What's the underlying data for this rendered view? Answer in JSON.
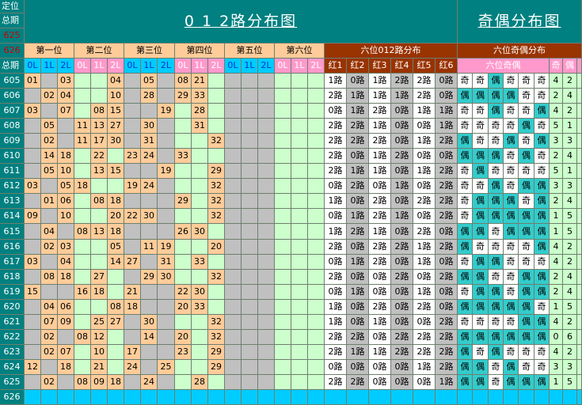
{
  "header": {
    "label_position": "定位",
    "label_total": "总期",
    "label_625": "625",
    "label_626": "626",
    "title_012": "0 1 2路分布图",
    "title_parity": "奇偶分布图",
    "title_012_six": "六位012路分布",
    "title_parity_six": "六位奇偶分布",
    "groups": [
      "第一位",
      "第二位",
      "第三位",
      "第四位",
      "第五位",
      "第六位"
    ],
    "sub_labels": [
      "0L",
      "1L",
      "2L"
    ],
    "red_labels": [
      "红1",
      "红2",
      "红3",
      "红4",
      "红5",
      "红6"
    ],
    "parity_sub": "六位奇偶",
    "odd_label": "奇",
    "even_label": "偶"
  },
  "rows": [
    {
      "p": "605",
      "n": [
        "01",
        null,
        "03",
        null,
        null,
        "04",
        null,
        "05",
        null,
        "08",
        "21",
        null
      ],
      "r": [
        "1路",
        "0路",
        "1路",
        "2路",
        "2路",
        "0路"
      ],
      "o": [
        "奇",
        "奇",
        "偶",
        "奇",
        "奇",
        "奇"
      ],
      "s": [
        "4",
        "2"
      ]
    },
    {
      "p": "606",
      "n": [
        null,
        "02",
        "04",
        null,
        null,
        "10",
        null,
        "28",
        null,
        "29",
        "33",
        null
      ],
      "r": [
        "2路",
        "1路",
        "1路",
        "1路",
        "2路",
        "0路"
      ],
      "o": [
        "偶",
        "偶",
        "偶",
        "偶",
        "奇",
        "奇"
      ],
      "s": [
        "2",
        "4"
      ]
    },
    {
      "p": "607",
      "n": [
        "03",
        null,
        "07",
        null,
        "08",
        "15",
        null,
        null,
        "19",
        null,
        "28",
        null
      ],
      "r": [
        "0路",
        "1路",
        "2路",
        "0路",
        "1路",
        "1路"
      ],
      "o": [
        "奇",
        "奇",
        "偶",
        "奇",
        "奇",
        "偶"
      ],
      "s": [
        "4",
        "2"
      ]
    },
    {
      "p": "608",
      "n": [
        null,
        "05",
        null,
        "11",
        "13",
        "27",
        null,
        "30",
        null,
        null,
        "31",
        null
      ],
      "r": [
        "2路",
        "2路",
        "1路",
        "0路",
        "0路",
        "1路"
      ],
      "o": [
        "奇",
        "奇",
        "奇",
        "奇",
        "偶",
        "奇"
      ],
      "s": [
        "5",
        "1"
      ]
    },
    {
      "p": "609",
      "n": [
        null,
        "02",
        null,
        "11",
        "17",
        "30",
        null,
        "31",
        null,
        null,
        null,
        "32"
      ],
      "r": [
        "2路",
        "2路",
        "2路",
        "0路",
        "1路",
        "2路"
      ],
      "o": [
        "偶",
        "奇",
        "奇",
        "偶",
        "奇",
        "偶"
      ],
      "s": [
        "3",
        "3"
      ]
    },
    {
      "p": "610",
      "n": [
        null,
        "14",
        "18",
        null,
        "22",
        null,
        "23",
        "24",
        null,
        "33",
        null,
        null
      ],
      "r": [
        "2路",
        "0路",
        "1路",
        "2路",
        "0路",
        "0路"
      ],
      "o": [
        "偶",
        "偶",
        "偶",
        "奇",
        "偶",
        "奇"
      ],
      "s": [
        "2",
        "4"
      ]
    },
    {
      "p": "611",
      "n": [
        null,
        "05",
        "10",
        null,
        "13",
        "15",
        null,
        null,
        "19",
        null,
        null,
        "29"
      ],
      "r": [
        "2路",
        "1路",
        "1路",
        "0路",
        "1路",
        "2路"
      ],
      "o": [
        "奇",
        "偶",
        "奇",
        "奇",
        "奇",
        "奇"
      ],
      "s": [
        "5",
        "1"
      ]
    },
    {
      "p": "612",
      "n": [
        "03",
        null,
        "05",
        "18",
        null,
        null,
        "19",
        "24",
        null,
        null,
        null,
        "32"
      ],
      "r": [
        "0路",
        "2路",
        "0路",
        "1路",
        "0路",
        "2路"
      ],
      "o": [
        "奇",
        "奇",
        "偶",
        "奇",
        "偶",
        "偶"
      ],
      "s": [
        "3",
        "3"
      ]
    },
    {
      "p": "613",
      "n": [
        null,
        "01",
        "06",
        null,
        "08",
        "18",
        null,
        null,
        null,
        "29",
        null,
        "32"
      ],
      "r": [
        "1路",
        "0路",
        "2路",
        "0路",
        "2路",
        "2路"
      ],
      "o": [
        "奇",
        "偶",
        "偶",
        "偶",
        "奇",
        "偶"
      ],
      "s": [
        "2",
        "4"
      ]
    },
    {
      "p": "614",
      "n": [
        "09",
        null,
        "10",
        null,
        null,
        "20",
        "22",
        "30",
        null,
        null,
        null,
        "32"
      ],
      "r": [
        "0路",
        "1路",
        "2路",
        "1路",
        "0路",
        "2路"
      ],
      "o": [
        "奇",
        "偶",
        "偶",
        "偶",
        "偶",
        "偶"
      ],
      "s": [
        "1",
        "5"
      ]
    },
    {
      "p": "615",
      "n": [
        null,
        "04",
        null,
        "08",
        "13",
        "18",
        null,
        null,
        null,
        "26",
        "30",
        null
      ],
      "r": [
        "1路",
        "2路",
        "1路",
        "0路",
        "2路",
        "0路"
      ],
      "o": [
        "偶",
        "偶",
        "奇",
        "偶",
        "偶",
        "偶"
      ],
      "s": [
        "1",
        "5"
      ]
    },
    {
      "p": "616",
      "n": [
        null,
        "02",
        "03",
        null,
        null,
        "05",
        null,
        "11",
        "19",
        null,
        null,
        "20"
      ],
      "r": [
        "2路",
        "0路",
        "2路",
        "2路",
        "1路",
        "2路"
      ],
      "o": [
        "偶",
        "奇",
        "奇",
        "奇",
        "奇",
        "偶"
      ],
      "s": [
        "4",
        "2"
      ]
    },
    {
      "p": "617",
      "n": [
        "03",
        null,
        "04",
        null,
        null,
        "14",
        "27",
        null,
        "31",
        null,
        "33",
        null
      ],
      "r": [
        "0路",
        "1路",
        "2路",
        "0路",
        "1路",
        "0路"
      ],
      "o": [
        "奇",
        "偶",
        "偶",
        "奇",
        "奇",
        "奇"
      ],
      "s": [
        "4",
        "2"
      ]
    },
    {
      "p": "618",
      "n": [
        null,
        "08",
        "18",
        null,
        "27",
        null,
        null,
        "29",
        "30",
        null,
        null,
        "32"
      ],
      "r": [
        "2路",
        "0路",
        "0路",
        "2路",
        "0路",
        "2路"
      ],
      "o": [
        "偶",
        "偶",
        "奇",
        "奇",
        "偶",
        "偶"
      ],
      "s": [
        "2",
        "4"
      ]
    },
    {
      "p": "619",
      "n": [
        "15",
        null,
        null,
        "16",
        "18",
        null,
        "21",
        null,
        null,
        "22",
        "30",
        null
      ],
      "r": [
        "0路",
        "1路",
        "0路",
        "0路",
        "1路",
        "0路"
      ],
      "o": [
        "奇",
        "偶",
        "偶",
        "奇",
        "偶",
        "偶"
      ],
      "s": [
        "2",
        "4"
      ]
    },
    {
      "p": "620",
      "n": [
        null,
        "04",
        "06",
        null,
        null,
        "08",
        "18",
        null,
        null,
        "20",
        "33",
        null
      ],
      "r": [
        "1路",
        "0路",
        "2路",
        "0路",
        "2路",
        "0路"
      ],
      "o": [
        "偶",
        "偶",
        "偶",
        "偶",
        "偶",
        "奇"
      ],
      "s": [
        "1",
        "5"
      ]
    },
    {
      "p": "621",
      "n": [
        null,
        "07",
        "09",
        null,
        "25",
        "27",
        null,
        "30",
        null,
        null,
        null,
        "32"
      ],
      "r": [
        "1路",
        "0路",
        "1路",
        "0路",
        "0路",
        "2路"
      ],
      "o": [
        "奇",
        "奇",
        "奇",
        "奇",
        "偶",
        "偶"
      ],
      "s": [
        "4",
        "2"
      ]
    },
    {
      "p": "622",
      "n": [
        null,
        "02",
        null,
        "08",
        "12",
        null,
        null,
        "14",
        null,
        "20",
        null,
        "32"
      ],
      "r": [
        "2路",
        "2路",
        "0路",
        "2路",
        "2路",
        "2路"
      ],
      "o": [
        "偶",
        "偶",
        "偶",
        "偶",
        "偶",
        "偶"
      ],
      "s": [
        "0",
        "6"
      ]
    },
    {
      "p": "623",
      "n": [
        null,
        "02",
        "07",
        null,
        "10",
        null,
        "17",
        null,
        null,
        "23",
        null,
        "29"
      ],
      "r": [
        "2路",
        "1路",
        "1路",
        "2路",
        "2路",
        "2路"
      ],
      "o": [
        "偶",
        "奇",
        "偶",
        "奇",
        "奇",
        "奇"
      ],
      "s": [
        "4",
        "2"
      ]
    },
    {
      "p": "624",
      "n": [
        "12",
        null,
        "18",
        null,
        "21",
        null,
        "24",
        null,
        "25",
        null,
        null,
        "29"
      ],
      "r": [
        "0路",
        "0路",
        "0路",
        "0路",
        "1路",
        "2路"
      ],
      "o": [
        "偶",
        "偶",
        "奇",
        "偶",
        "奇",
        "奇"
      ],
      "s": [
        "3",
        "3"
      ]
    },
    {
      "p": "625",
      "n": [
        null,
        "02",
        null,
        "08",
        "09",
        "18",
        null,
        "24",
        null,
        null,
        "28",
        null
      ],
      "r": [
        "2路",
        "2路",
        "0路",
        "0路",
        "0路",
        "1路"
      ],
      "o": [
        "偶",
        "偶",
        "奇",
        "偶",
        "偶",
        "偶"
      ],
      "s": [
        "1",
        "5"
      ]
    }
  ],
  "colors": {
    "teal": "#008080",
    "light_green": "#ccffcc",
    "gray": "#c0c0c0",
    "cyan": "#00ccff",
    "orange": "#ffcc99",
    "pink": "#ff99cc",
    "sky": "#99ccff",
    "brown": "#993300",
    "pale_green": "#ccffcc",
    "teal_cell": "#33cccc"
  }
}
